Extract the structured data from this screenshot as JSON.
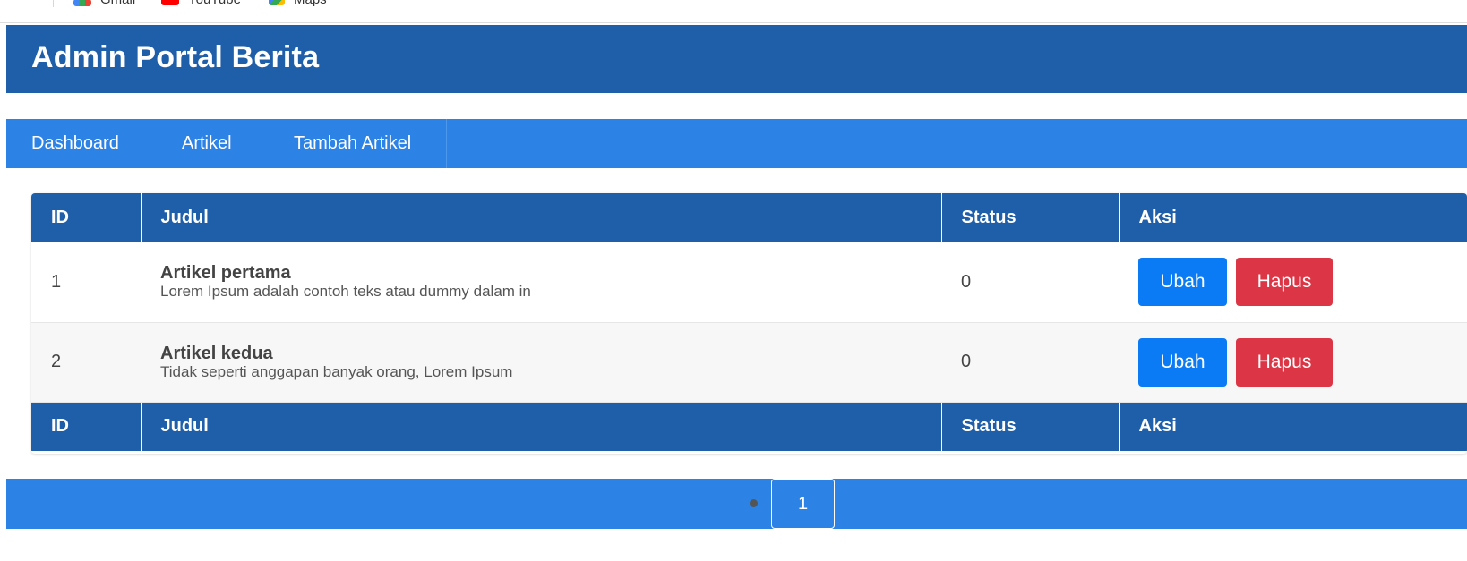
{
  "browser": {
    "bookmarks": [
      {
        "label": "Gmail",
        "icon": "gmail-icon"
      },
      {
        "label": "YouTube",
        "icon": "youtube-icon"
      },
      {
        "label": "Maps",
        "icon": "maps-icon"
      }
    ]
  },
  "header": {
    "title": "Admin Portal Berita"
  },
  "nav": {
    "items": [
      {
        "label": "Dashboard"
      },
      {
        "label": "Artikel"
      },
      {
        "label": "Tambah Artikel"
      }
    ]
  },
  "table": {
    "headers": {
      "id": "ID",
      "judul": "Judul",
      "status": "Status",
      "aksi": "Aksi"
    },
    "rows": [
      {
        "id": "1",
        "title": "Artikel pertama",
        "excerpt": "Lorem Ipsum adalah contoh teks atau dummy dalam in",
        "status": "0",
        "edit_label": "Ubah",
        "delete_label": "Hapus"
      },
      {
        "id": "2",
        "title": "Artikel kedua",
        "excerpt": "Tidak seperti anggapan banyak orang, Lorem Ipsum",
        "status": "0",
        "edit_label": "Ubah",
        "delete_label": "Hapus"
      }
    ],
    "footer_headers": {
      "id": "ID",
      "judul": "Judul",
      "status": "Status",
      "aksi": "Aksi"
    }
  },
  "pagination": {
    "current_page": "1"
  },
  "colors": {
    "header_bg": "#1f5faa",
    "nav_bg": "#2d82e6",
    "edit_button": "#0a7bf5",
    "delete_button": "#dc3545"
  }
}
